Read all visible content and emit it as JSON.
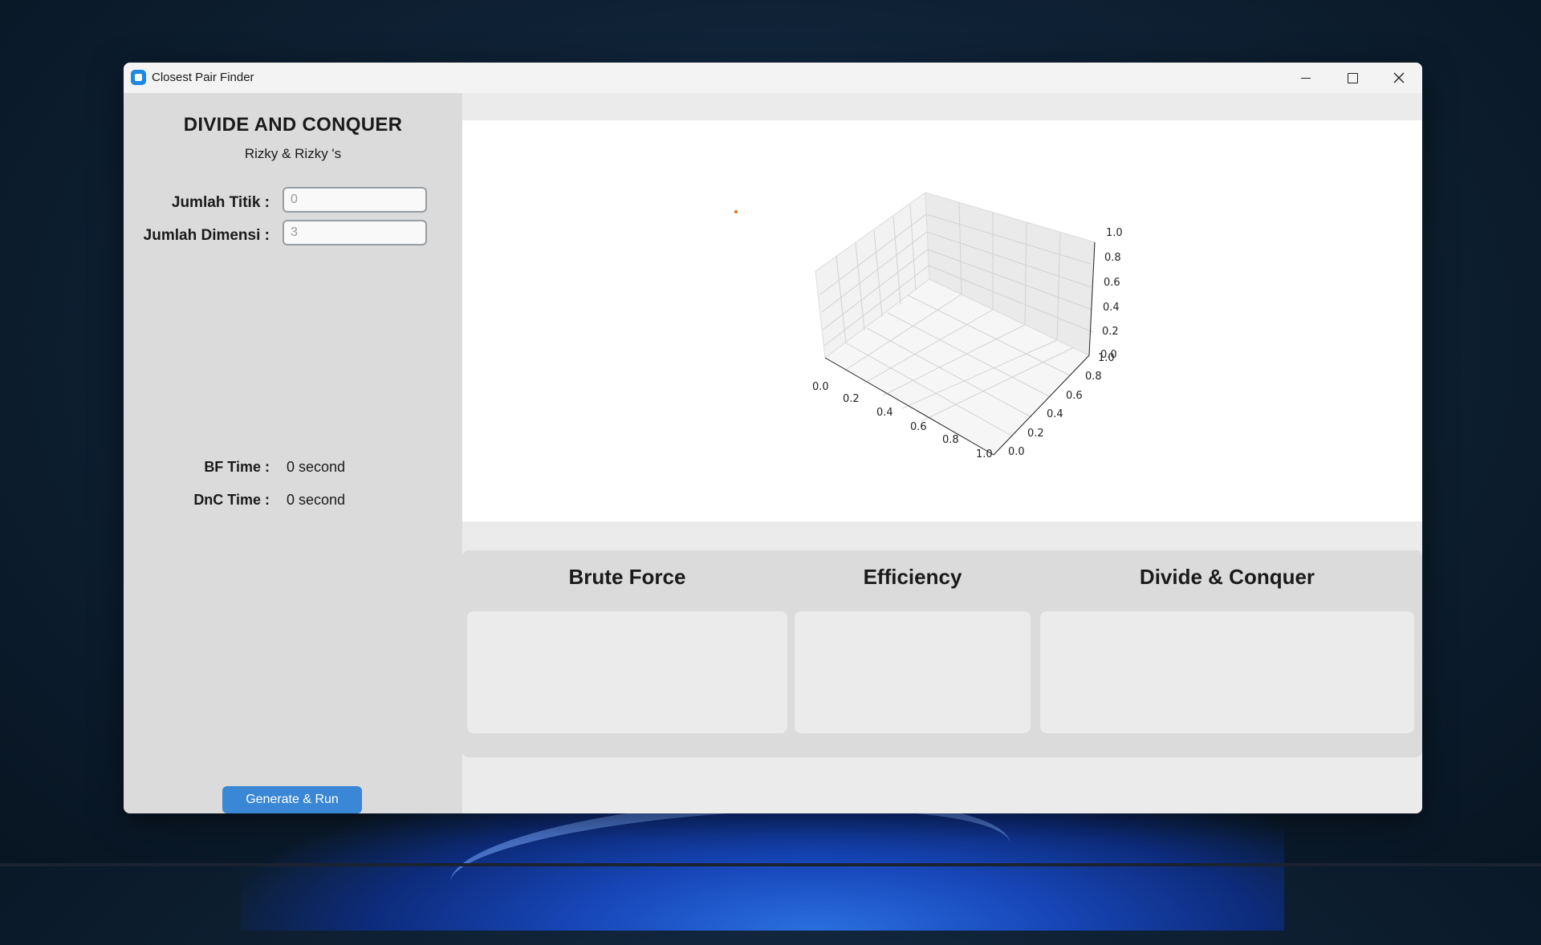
{
  "window": {
    "title": "Closest Pair Finder"
  },
  "sidebar": {
    "heading": "DIVIDE AND CONQUER",
    "subtitle": "Rizky & Rizky 's",
    "fields": [
      {
        "label": "Jumlah Titik :",
        "value": "",
        "placeholder": "0"
      },
      {
        "label": "Jumlah Dimensi :",
        "value": "",
        "placeholder": "3"
      }
    ],
    "times": [
      {
        "label": "BF Time :",
        "value": "0 second"
      },
      {
        "label": "DnC Time :",
        "value": "0 second"
      }
    ],
    "run_button": "Generate & Run"
  },
  "plot": {
    "x_ticks": [
      "0.0",
      "0.2",
      "0.4",
      "0.6",
      "0.8",
      "1.0"
    ],
    "y_ticks": [
      "0.0",
      "0.2",
      "0.4",
      "0.6",
      "0.8",
      "1.0"
    ],
    "z_ticks": [
      "0.0",
      "0.2",
      "0.4",
      "0.6",
      "0.8",
      "1.0"
    ],
    "point_color": "#e8641b"
  },
  "results": {
    "brute_force": "Brute Force",
    "efficiency": "Efficiency",
    "divide_conquer": "Divide & Conquer"
  },
  "colors": {
    "accent": "#3a87d6",
    "sidebar_bg": "#dbdbdb",
    "app_icon": "#1e88e5"
  }
}
